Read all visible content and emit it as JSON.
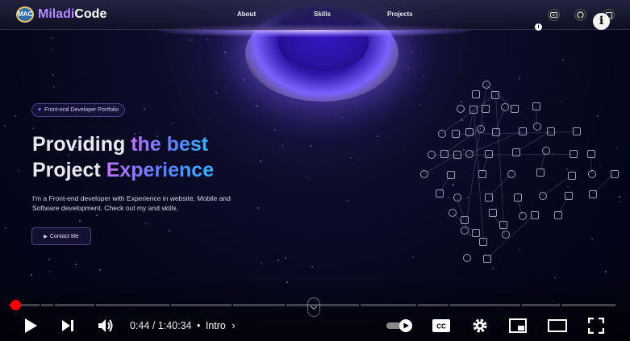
{
  "site": {
    "logo_badge": "MAC",
    "brand_part1": "Miladi",
    "brand_part2": "Code",
    "nav": [
      "About",
      "Skills",
      "Projects"
    ],
    "social_icons": [
      "youtube-icon",
      "github-icon",
      "linkedin-icon"
    ],
    "info_small": "i",
    "info_big": "i"
  },
  "hero": {
    "pill": "Front-end Developer Portfolio",
    "headline_line1_plain": "Providing ",
    "headline_line1_grad": "the best",
    "headline_line2_plain": "Project ",
    "headline_line2_grad": "Experience",
    "subtitle": "I'm a Front-end developer with Experience in website, Mobile and Software development. Check out my and skills.",
    "cta": "Contact Me"
  },
  "player": {
    "time_current": "0:44",
    "time_total": "1:40:34",
    "chapter": "Intro",
    "separator": "/",
    "bullet": "•",
    "progress_fraction": 0.0073,
    "accent": "#ff0000"
  },
  "colors": {
    "brand_purple": "#b38cff",
    "gradient_start": "#c071ff",
    "gradient_end": "#31b6ff"
  }
}
